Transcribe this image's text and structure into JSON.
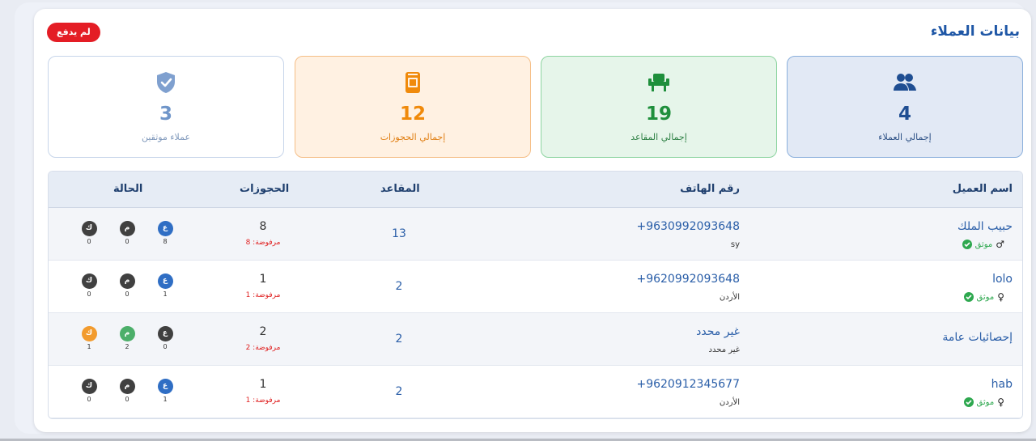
{
  "header": {
    "title": "بيانات العملاء",
    "badge": "لم يدفع"
  },
  "stats": [
    {
      "id": "customers",
      "value": "4",
      "label": "إجمالي العملاء",
      "icon": "users-icon",
      "color": "#1f4e92"
    },
    {
      "id": "seats",
      "value": "19",
      "label": "إجمالي المقاعد",
      "icon": "seat-icon",
      "color": "#1f8f3c"
    },
    {
      "id": "bookings",
      "value": "12",
      "label": "إجمالي الحجوزات",
      "icon": "ticket-icon",
      "color": "#f08a0b"
    },
    {
      "id": "verified",
      "value": "3",
      "label": "عملاء موثقين",
      "icon": "shield-check-icon",
      "color": "#6f95c9"
    }
  ],
  "table": {
    "headers": {
      "name": "اسم العميل",
      "phone": "رقم الهاتف",
      "seats": "المقاعد",
      "bookings": "الحجوزات",
      "status": "الحالة"
    },
    "rows": [
      {
        "name": "حبيب الملك",
        "verified": "موثق",
        "gender": "♂",
        "phone": "+9630992093648",
        "country": "sy",
        "seats": "13",
        "bookings": "8",
        "rejected": "مرفوضة: 8",
        "status": [
          {
            "letter": "ع",
            "count": "8",
            "color": "blue"
          },
          {
            "letter": "م",
            "count": "0",
            "color": "dark"
          },
          {
            "letter": "ك",
            "count": "0",
            "color": "dark"
          }
        ]
      },
      {
        "name": "lolo",
        "verified": "موثق",
        "gender": "♀",
        "phone": "+9620992093648",
        "country": "الأردن",
        "seats": "2",
        "bookings": "1",
        "rejected": "مرفوضة: 1",
        "status": [
          {
            "letter": "ع",
            "count": "1",
            "color": "blue"
          },
          {
            "letter": "م",
            "count": "0",
            "color": "dark"
          },
          {
            "letter": "ك",
            "count": "0",
            "color": "dark"
          }
        ]
      },
      {
        "name": "إحصائيات عامة",
        "verified": "",
        "gender": "",
        "phone": "غير محدد",
        "country": "غير محدد",
        "seats": "2",
        "bookings": "2",
        "rejected": "مرفوضة: 2",
        "status": [
          {
            "letter": "ع",
            "count": "0",
            "color": "dark"
          },
          {
            "letter": "م",
            "count": "2",
            "color": "green"
          },
          {
            "letter": "ك",
            "count": "1",
            "color": "orange"
          }
        ]
      },
      {
        "name": "hab",
        "verified": "موثق",
        "gender": "♀",
        "phone": "+9620912345677",
        "country": "الأردن",
        "seats": "2",
        "bookings": "1",
        "rejected": "مرفوضة: 1",
        "status": [
          {
            "letter": "ع",
            "count": "1",
            "color": "blue"
          },
          {
            "letter": "م",
            "count": "0",
            "color": "dark"
          },
          {
            "letter": "ك",
            "count": "0",
            "color": "dark"
          }
        ]
      }
    ]
  }
}
